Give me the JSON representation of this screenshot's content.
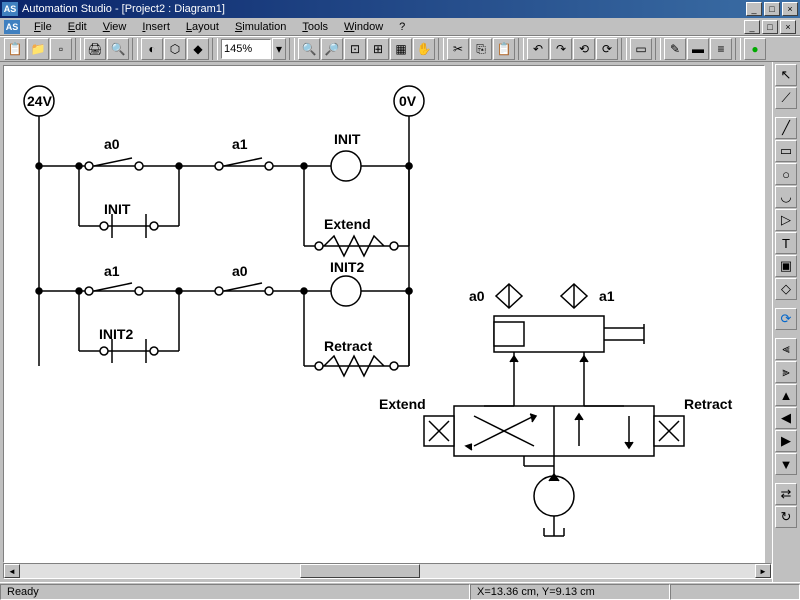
{
  "app": {
    "title": "Automation Studio - [Project2 : Diagram1]",
    "icon_text": "AS"
  },
  "menu": {
    "file": "File",
    "edit": "Edit",
    "view": "View",
    "insert": "Insert",
    "layout": "Layout",
    "simulation": "Simulation",
    "tools": "Tools",
    "window": "Window",
    "help": "?"
  },
  "toolbar": {
    "zoom": "145%"
  },
  "status": {
    "ready": "Ready",
    "coords": "X=13.36 cm, Y=9.13 cm"
  },
  "diagram": {
    "node_24v": "24V",
    "node_0v": "0V",
    "lbl_a0_top": "a0",
    "lbl_a1_top": "a1",
    "lbl_init": "INIT",
    "lbl_init_mid": "INIT",
    "lbl_extend_coil": "Extend",
    "lbl_a1_bot": "a1",
    "lbl_a0_bot": "a0",
    "lbl_init2": "INIT2",
    "lbl_init2_mid": "INIT2",
    "lbl_retract_coil": "Retract",
    "cyl_a0": "a0",
    "cyl_a1": "a1",
    "valve_extend": "Extend",
    "valve_retract": "Retract"
  }
}
